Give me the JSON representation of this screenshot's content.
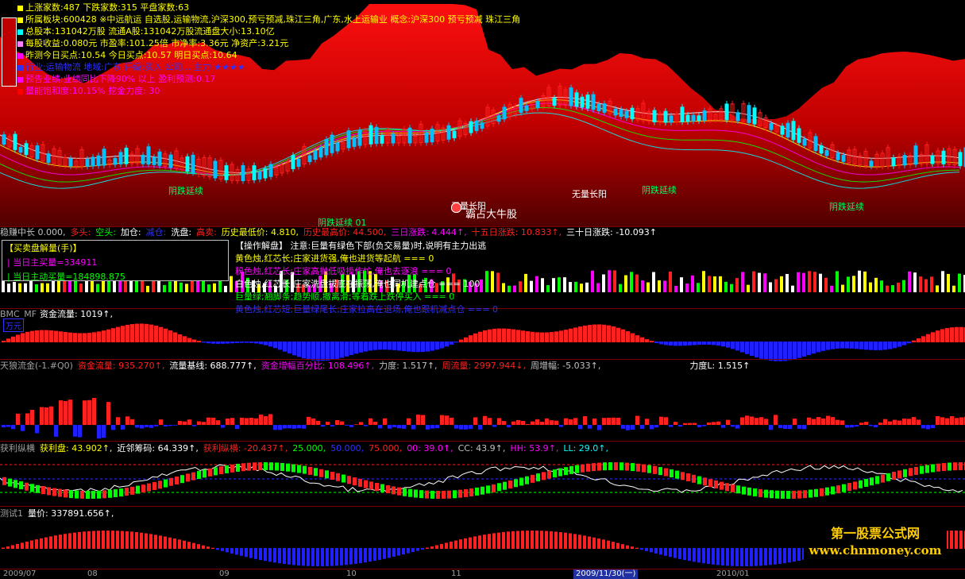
{
  "info_lines": [
    {
      "text": "上涨家数:487   下跌家数:315   平盘家数:63",
      "color": "#ffff00",
      "sq": "#ffff00"
    },
    {
      "text": "所属板块:600428 ※中远航运 自选股,运输物流,沪深300,预亏预减,珠江三角,广东,水上运输业  概念:沪深300 预亏预减 珠江三角",
      "color": "#ffff00",
      "sq": "#ffff00"
    },
    {
      "text": "总股本:131042万股  流通A股:131042万股流通盘大小:13.10亿",
      "color": "#ffff00",
      "sq": "#00ffff"
    },
    {
      "text": "每股收益:0.080元  市盈率:101.25倍  市净率:3.36元  净资产:3.21元",
      "color": "#ffff00",
      "sq": "#ff80ff"
    },
    {
      "text": "昨测今日买点:10.54   今日买点:10.57   明日买点:10.64",
      "color": "#ffff00",
      "sq": "#ff00ff"
    },
    {
      "text": "行业:运输物流  地域:广东  评级:买入 公司...  主力:★★★★",
      "color": "#3030ff",
      "sq": "#3030ff"
    },
    {
      "text": "预告业绩:业绩同比下降90% 以上  盈利预测:0.17",
      "color": "#ff00ff",
      "sq": "#ff00ff"
    },
    {
      "text": "量能饱和度:10.15%  挖金力度:    30",
      "color": "#ff00ff",
      "sq": "#ff0000"
    }
  ],
  "annotations": [
    {
      "text": "阴跌延续",
      "color": "#00ff60"
    },
    {
      "text": "阴跌延续 01",
      "color": "#00ff60"
    },
    {
      "text": "无量长阳",
      "color": "#ffffff"
    },
    {
      "text": "霸占大牛股",
      "color": "#ffffff"
    },
    {
      "text": "无量长阳",
      "color": "#ffffff"
    },
    {
      "text": "阴跌延续",
      "color": "#00ff60"
    },
    {
      "text": "阴跌延续",
      "color": "#00ff60"
    }
  ],
  "stat_row": {
    "a": "稳赚中长 0.000,",
    "b": "多头:",
    "c": "空头:",
    "d": "加仓:",
    "e": "减仓:",
    "f": "洗盘:",
    "g": "高卖:",
    "h": "历史最低价: 4.810,",
    "i": "历史最高价: 44.500,",
    "j": "三日涨跌: 4.444↑,",
    "k": "十五日涨跌: 10.833↑,",
    "l": "三十日涨跌: -10.093↑"
  },
  "buy_sell_box": {
    "title": "【买卖盘解量(手)】",
    "line1": "| 当日主买量=334911",
    "line2": "| 当日主动买量=184898.875"
  },
  "operation_panel": {
    "title": "【操作解盘】 注意:巨量有绿色下部(负交易量)时,说明有主力出逃",
    "l1": "黄色烛,红芯长;庄家进货强,俺也进货等起航 === 0",
    "l2": "粉色烛,红芯长;庄家高抛低吸操作忙,俺也去逐浪 === 0",
    "l3": "白色烛,红芯长;庄家洗盘拔底在振荡,俺也伺机建点仓 === 100",
    "l4": "巨量绿;翘脚条;趋势顺,撤离滑;等着跌上跌停买入 === 0",
    "l5": "黄色烛,红芯短;巨量绿尾长;庄家拉高在退场,俺也跟机减点仓 === 0"
  },
  "bmc_row": {
    "name": "BMC_MF",
    "label": "资金流量: 1019↑,",
    "tag": "万元"
  },
  "tianlang_row": {
    "name": "天狼流金(-1.#Q0)",
    "a": "资金流量: 935.270↑,",
    "b": "流量基线: 688.777↑,",
    "c": "资金增幅百分比: 108.496↑,",
    "d": "力度: 1.517↑,",
    "e": "周流量: 2997.944↓,",
    "f": "周增幅: -5.033↑,",
    "g": "力度L: 1.515↑"
  },
  "huoli_row": {
    "name": "获利纵横",
    "a": "获利盘: 43.902↑,",
    "b": "近邻筹码: 64.339↑,",
    "c": "获利纵横: -20.437↑,",
    "d": "25.000,",
    "e": "50.000,",
    "f": "75.000,",
    "g": "00: 39.0↑,",
    "h": "CC: 43.9↑,",
    "i": "HH: 53.9↑,",
    "j": "LL: 29.0↑,"
  },
  "test_row": {
    "name": "测试1",
    "a": "量价: 337891.656↑,"
  },
  "dates": [
    "2009/07",
    "08",
    "09",
    "10",
    "11",
    "2009/11/30(一)",
    "2010/01"
  ],
  "watermark": {
    "line1": "第一股票公式网",
    "line2": "www.chnmoney.com"
  },
  "colors": {
    "up": "#ff2020",
    "down": "#00ffff",
    "bg": "#000000",
    "red_fill": "#aa0000",
    "frame": "#7a0000",
    "accent_green": "#00ff00",
    "accent_yellow": "#ffff00"
  }
}
